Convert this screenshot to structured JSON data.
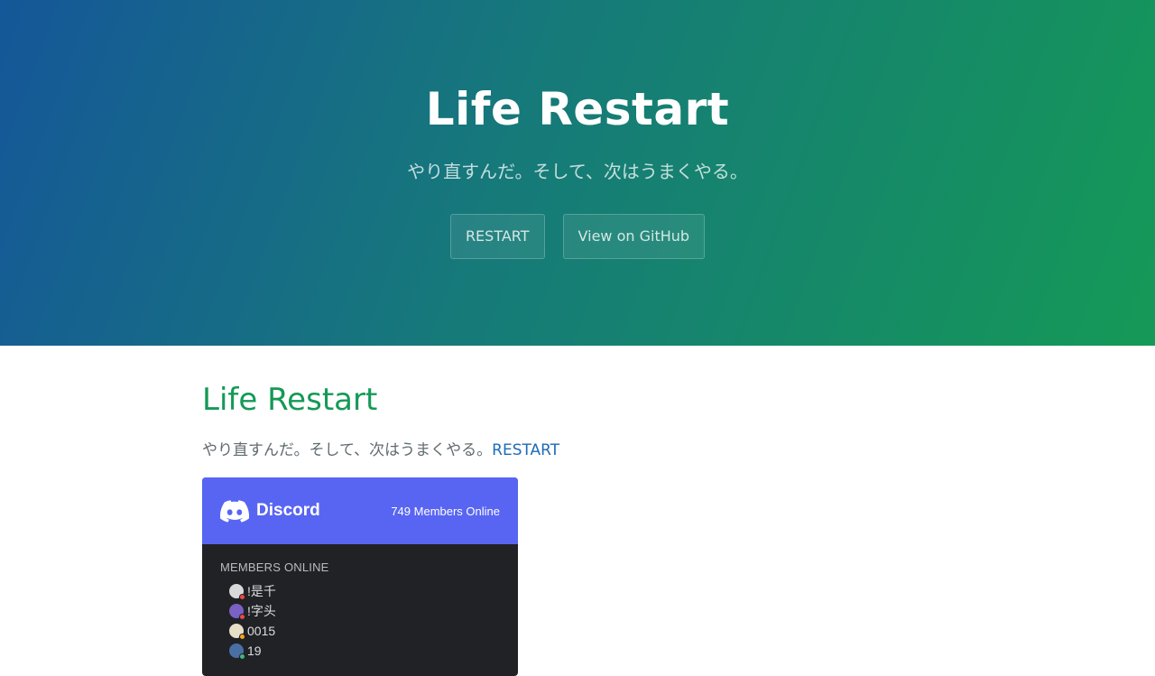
{
  "hero": {
    "title": "Life Restart",
    "tagline": "やり直すんだ。そして、次はうまくやる。",
    "buttons": [
      {
        "label": "RESTART"
      },
      {
        "label": "View on GitHub"
      }
    ]
  },
  "main": {
    "heading": "Life Restart",
    "paragraph": "やり直すんだ。そして、次はうまくやる。",
    "link_label": "RESTART"
  },
  "discord": {
    "brand": "Discord",
    "members_online_count": "749 Members Online",
    "section_label": "MEMBERS ONLINE",
    "members": [
      {
        "name": "!是千",
        "avatar_color": "#d9d9d9",
        "status_color": "#f04747"
      },
      {
        "name": "!字头",
        "avatar_color": "#7b61c4",
        "status_color": "#f04747"
      },
      {
        "name": "0015",
        "avatar_color": "#e8dfc9",
        "status_color": "#faa61a"
      },
      {
        "name": "19",
        "avatar_color": "#4a6fa5",
        "status_color": "#43b581"
      }
    ]
  },
  "colors": {
    "hero_gradient_start": "#155799",
    "hero_gradient_end": "#159957",
    "heading_green": "#159957",
    "link_blue": "#1e6bb8",
    "discord_blurple": "#5865f2",
    "discord_dark": "#202225"
  }
}
